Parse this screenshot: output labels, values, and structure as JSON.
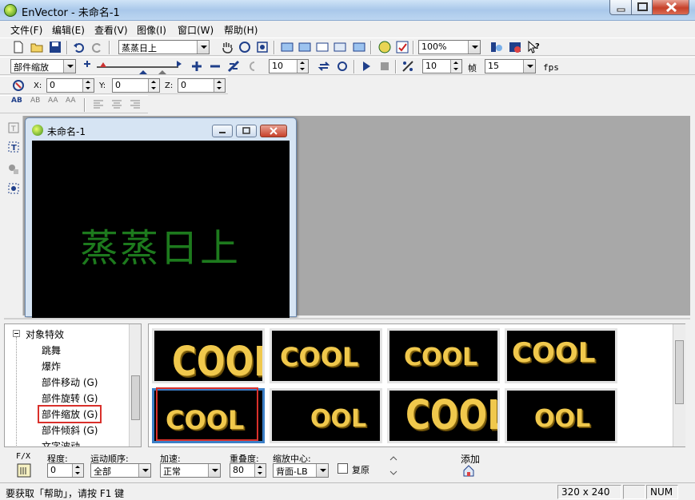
{
  "window": {
    "title": "EnVector - 未命名-1"
  },
  "menu": [
    "文件(F)",
    "编辑(E)",
    "查看(V)",
    "图像(I)",
    "窗口(W)",
    "帮助(H)"
  ],
  "toolbar1": {
    "text_combo": "蒸蒸日上",
    "zoom_combo": "100%"
  },
  "toolbar2": {
    "effect_combo": "部件缩放",
    "frame_value": "10",
    "speed_value": "10",
    "frame_label": "帧",
    "fps_value": "15",
    "fps_label": "fps"
  },
  "toolbar3": {
    "x_label": "X:",
    "x_value": "0",
    "y_label": "Y:",
    "y_value": "0",
    "z_label": "Z:",
    "z_value": "0"
  },
  "toolbar4": {
    "icons": [
      "AB",
      "AB",
      "AA",
      "AA"
    ]
  },
  "document": {
    "title": "未命名-1",
    "canvas_text": "蒸蒸日上"
  },
  "tree": {
    "root": "对象特效",
    "items": [
      "跳舞",
      "爆炸",
      "部件移动 (G)",
      "部件旋转 (G)",
      "部件缩放 (G)",
      "部件倾斜 (G)",
      "文字波动"
    ],
    "selected_index": 4
  },
  "gallery": {
    "previews": [
      "COOL",
      "COOL",
      "COOL",
      "COOL",
      "COOL",
      "OOL",
      "COOL",
      "OOL"
    ],
    "selected_index": 4
  },
  "controls": {
    "fx_label": "F/X",
    "degree_label": "程度:",
    "degree_value": "0",
    "order_label": "运动顺序:",
    "order_value": "全部",
    "accel_label": "加速:",
    "accel_value": "正常",
    "overlap_label": "重叠度:",
    "overlap_value": "80",
    "center_label": "缩放中心:",
    "center_value": "背面-LB",
    "restore_label": "复原",
    "add_label": "添加"
  },
  "status": {
    "hint": "要获取「帮助」，请按 F1 键",
    "size": "320 x 240",
    "num": "NUM"
  },
  "colors": {
    "canvas_text": "#1d7a1d",
    "preview_text": "#f0c84c",
    "selection_box": "#d9302b"
  }
}
